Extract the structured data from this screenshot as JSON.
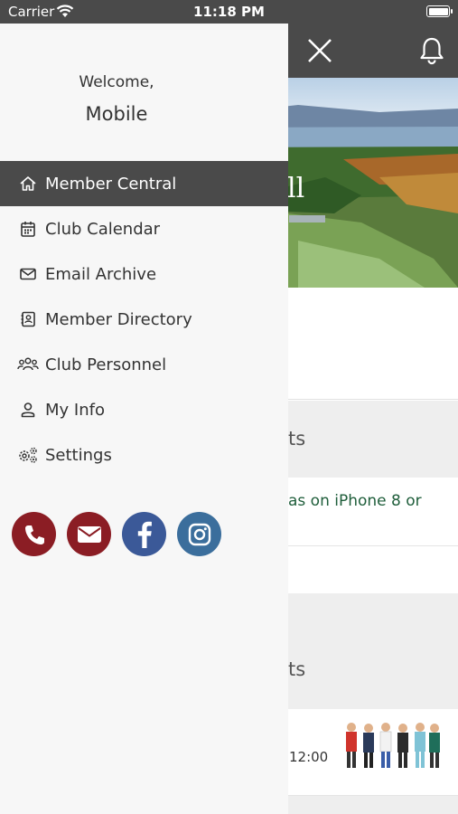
{
  "status_bar": {
    "carrier": "Carrier",
    "time": "11:18 PM"
  },
  "drawer": {
    "welcome": "Welcome,",
    "username": "Mobile",
    "items": [
      {
        "label": "Member Central",
        "icon": "home-icon",
        "active": true
      },
      {
        "label": "Club Calendar",
        "icon": "calendar-icon",
        "active": false
      },
      {
        "label": "Email Archive",
        "icon": "envelope-icon",
        "active": false
      },
      {
        "label": "Member Directory",
        "icon": "address-book-icon",
        "active": false
      },
      {
        "label": "Club Personnel",
        "icon": "users-icon",
        "active": false
      },
      {
        "label": "My Info",
        "icon": "user-icon",
        "active": false
      },
      {
        "label": "Settings",
        "icon": "gears-icon",
        "active": false
      }
    ],
    "social": [
      {
        "name": "phone-icon",
        "color": "#8b1d24"
      },
      {
        "name": "envelope-icon",
        "color": "#8b1d24"
      },
      {
        "name": "facebook-icon",
        "color": "#3b5998"
      },
      {
        "name": "instagram-icon",
        "color": "#3b6e9c"
      }
    ]
  },
  "background": {
    "hero_partial_text": "ll",
    "section1_title_partial": "ts",
    "news_link_partial": "as on iPhone 8 or",
    "section2_title_partial": "ts",
    "event_time_partial": "12:00"
  },
  "colors": {
    "header": "#4a4a4a",
    "drawer_bg": "#f7f7f7",
    "active_bg": "#4a4a4a",
    "link_green": "#1f5e3b"
  }
}
